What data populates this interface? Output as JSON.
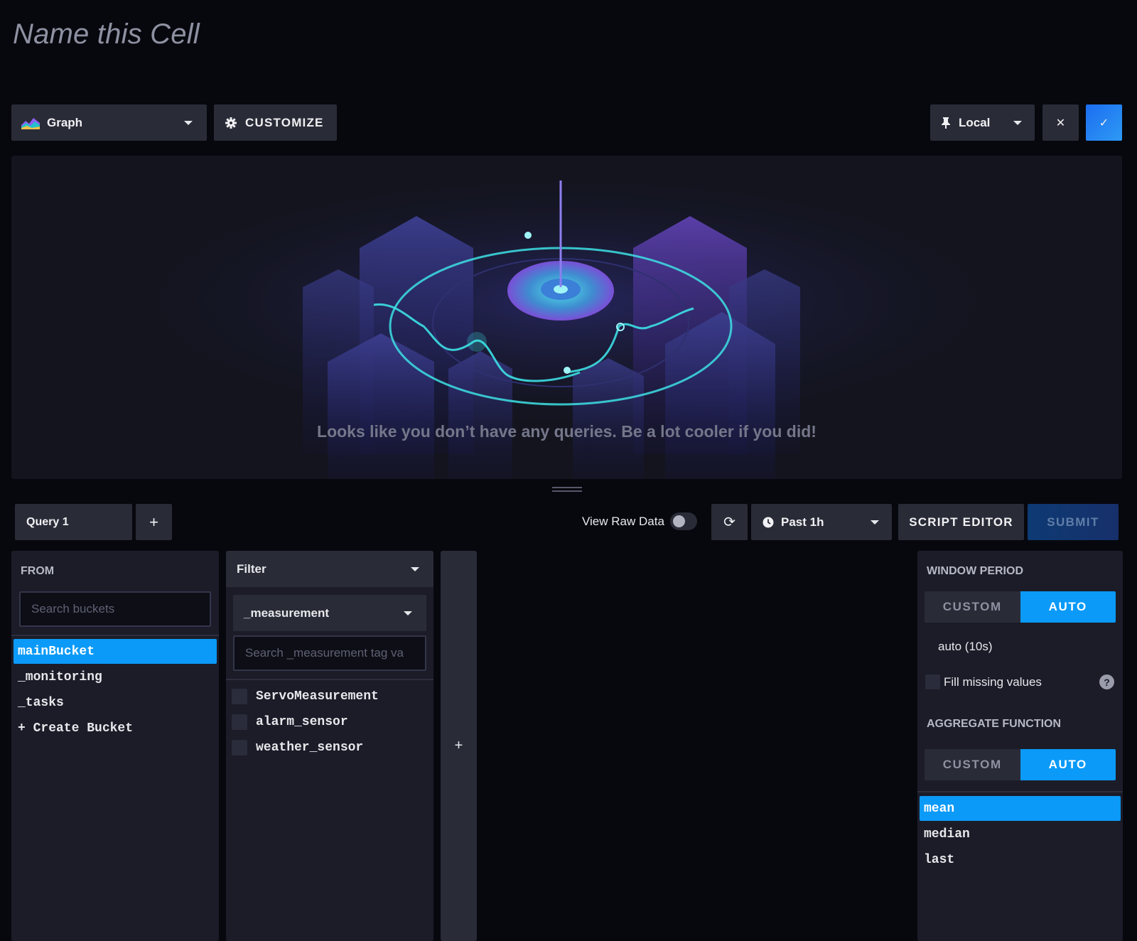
{
  "cell": {
    "title_placeholder": "Name this Cell"
  },
  "toolbar": {
    "visualization_type": "Graph",
    "customize_label": "CUSTOMIZE",
    "timezone": "Local",
    "cancel_glyph": "✕",
    "confirm_glyph": "✓"
  },
  "viz": {
    "empty_message": "Looks like you don’t have any queries. Be a lot cooler if you did!"
  },
  "query_bar": {
    "query_tab": "Query 1",
    "add_query_glyph": "+",
    "view_raw_label": "View Raw Data",
    "view_raw_enabled": false,
    "refresh_glyph": "⟳",
    "time_range": "Past 1h",
    "script_editor_label": "SCRIPT EDITOR",
    "submit_label": "SUBMIT"
  },
  "from_panel": {
    "heading": "FROM",
    "search_placeholder": "Search buckets",
    "buckets": [
      {
        "name": "mainBucket",
        "selected": true
      },
      {
        "name": "_monitoring",
        "selected": false
      },
      {
        "name": "_tasks",
        "selected": false
      },
      {
        "name": "+ Create Bucket",
        "selected": false
      }
    ]
  },
  "filter_panel": {
    "mode": "Filter",
    "key": "_measurement",
    "search_placeholder": "Search _measurement tag va",
    "tags": [
      {
        "name": "ServoMeasurement",
        "checked": false
      },
      {
        "name": "alarm_sensor",
        "checked": false
      },
      {
        "name": "weather_sensor",
        "checked": false
      }
    ],
    "add_filter_glyph": "+"
  },
  "aggregate_panel": {
    "window_heading": "WINDOW PERIOD",
    "window_custom": "CUSTOM",
    "window_auto": "AUTO",
    "auto_period": "auto (10s)",
    "fill_missing_label": "Fill missing values",
    "fill_missing_checked": false,
    "help_glyph": "?",
    "aggregate_heading": "AGGREGATE FUNCTION",
    "agg_custom": "CUSTOM",
    "agg_auto": "AUTO",
    "functions": [
      {
        "name": "mean",
        "selected": true
      },
      {
        "name": "median",
        "selected": false
      },
      {
        "name": "last",
        "selected": false
      }
    ]
  },
  "colors": {
    "background": "#07080e",
    "panel": "#1b1c28",
    "button": "#292b37",
    "accent": "#0b9af8",
    "confirm": "#1d6df0"
  },
  "icons": {
    "graph": "graph-icon",
    "gear": "gear-icon",
    "pin": "pin-icon",
    "clock": "clock-icon",
    "refresh": "refresh-icon",
    "help": "help-icon"
  }
}
